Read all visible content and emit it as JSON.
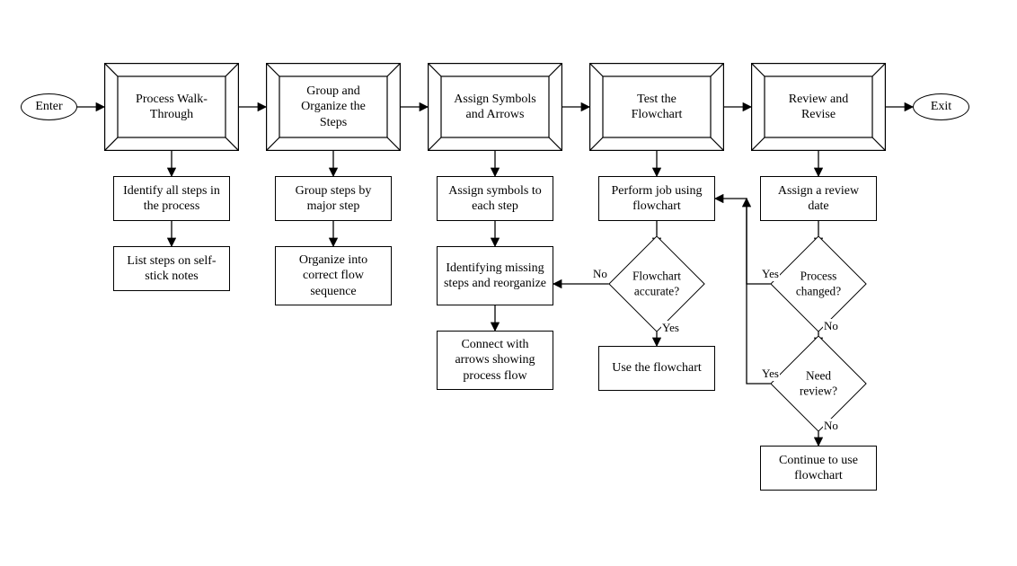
{
  "terminals": {
    "enter": "Enter",
    "exit": "Exit"
  },
  "bevel_steps": {
    "s1": "Process Walk-Through",
    "s2": "Group and Organize the Steps",
    "s3": "Assign Symbols and Arrows",
    "s4": "Test the Flowchart",
    "s5": "Review and Revise"
  },
  "tasks": {
    "s1a": "Identify all steps in the process",
    "s1b": "List steps on self-stick notes",
    "s2a": "Group steps by major step",
    "s2b": "Organize into correct flow sequence",
    "s3a": "Assign symbols to each step",
    "s3b": "Identifying missing steps and reorganize",
    "s3c": "Connect with arrows showing process flow",
    "s4a": "Perform job using flowchart",
    "s4c": "Use the flowchart",
    "s5a": "Assign a review date",
    "s5d": "Continue to use flowchart"
  },
  "decisions": {
    "d4": "Flowchart accurate?",
    "d5a": "Process changed?",
    "d5b": "Need review?"
  },
  "labels": {
    "yes": "Yes",
    "no": "No"
  }
}
